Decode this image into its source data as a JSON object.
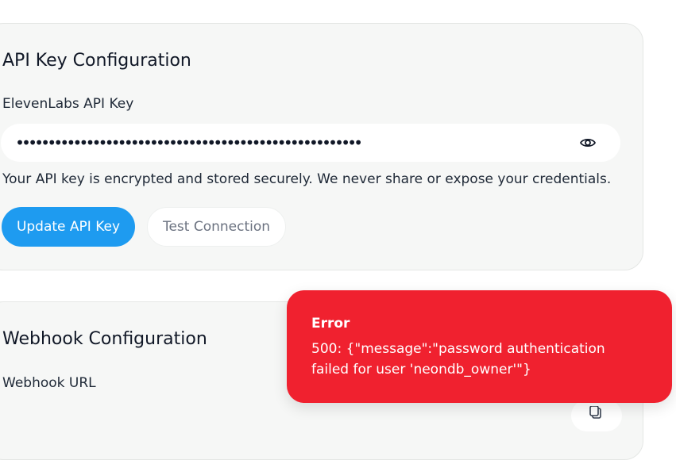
{
  "api_card": {
    "title": "API Key Configuration",
    "field_label": "ElevenLabs API Key",
    "masked_value": "••••••••••••••••••••••••••••••••••••••••••••••••••••••",
    "reveal_icon": "eye-icon",
    "helper_text": "Your API key is encrypted and stored securely. We never share or expose your credentials.",
    "update_button": "Update API Key",
    "test_button": "Test Connection"
  },
  "webhook_card": {
    "title": "Webhook Configuration",
    "field_label": "Webhook URL",
    "copy_icon": "copy-icon"
  },
  "toast": {
    "title": "Error",
    "message": "500: {\"message\":\"password authentication failed for user 'neondb_owner'\"}"
  },
  "colors": {
    "primary": "#1e9bf0",
    "error": "#f0212f",
    "card_bg": "#f6f7f6"
  }
}
